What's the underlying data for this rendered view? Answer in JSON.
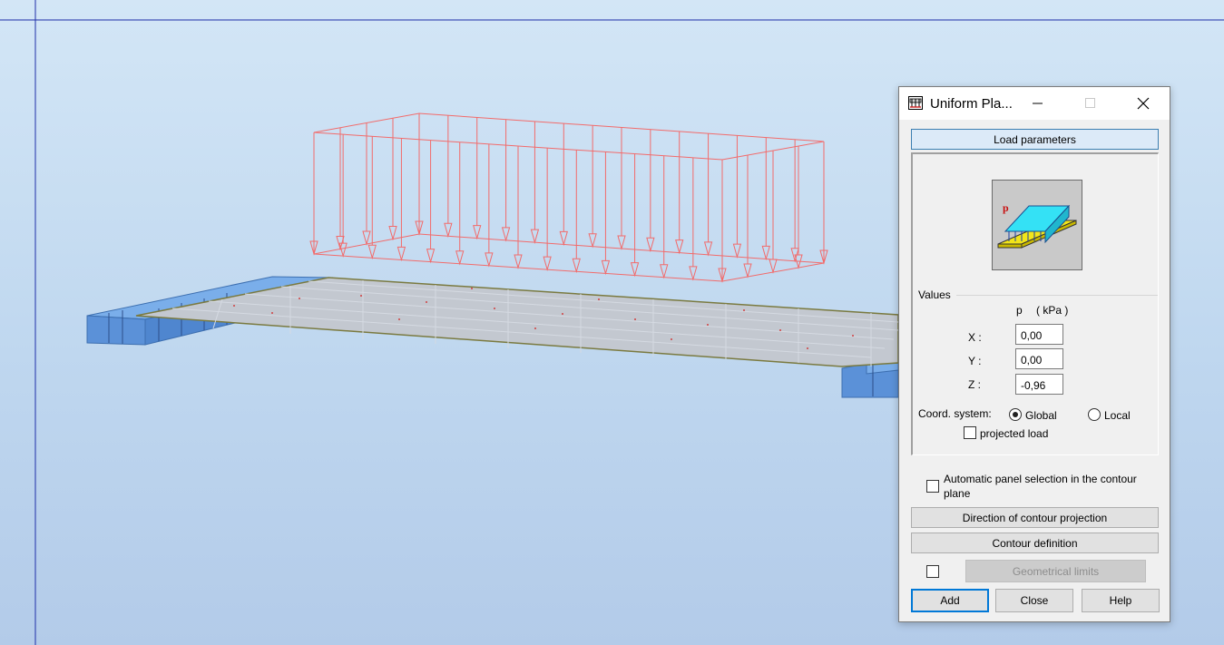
{
  "viewport": {
    "background_top": "#d3e6f6",
    "background_bottom": "#b3cbe9",
    "load_color": "#f26b6b",
    "slab_color": "#c3c8d0",
    "support_color": "#5e99e6",
    "axis_color": "#1f2fa8"
  },
  "dialog": {
    "title": "Uniform Pla...",
    "title_icon": "uniform-planar-load-icon",
    "tab_label": "Load parameters",
    "values_group": "Values",
    "unit_header_symbol": "p",
    "unit_header_unit": "( kPa )",
    "x_label": "X :",
    "y_label": "Y :",
    "z_label": "Z :",
    "x_value": "0,00",
    "y_value": "0,00",
    "z_value": "-0,96",
    "coord_label": "Coord. system:",
    "global_label": "Global",
    "local_label": "Local",
    "coord_selected": "Global",
    "projected_label": "projected load",
    "auto_panel_line1": "Automatic panel selection in the contour",
    "auto_panel_line2": "plane",
    "direction_btn": "Direction of contour projection",
    "contour_btn": "Contour definition",
    "geom_btn": "Geometrical limits",
    "add_btn": "Add",
    "close_btn": "Close",
    "help_btn": "Help",
    "preview_label": "p"
  }
}
